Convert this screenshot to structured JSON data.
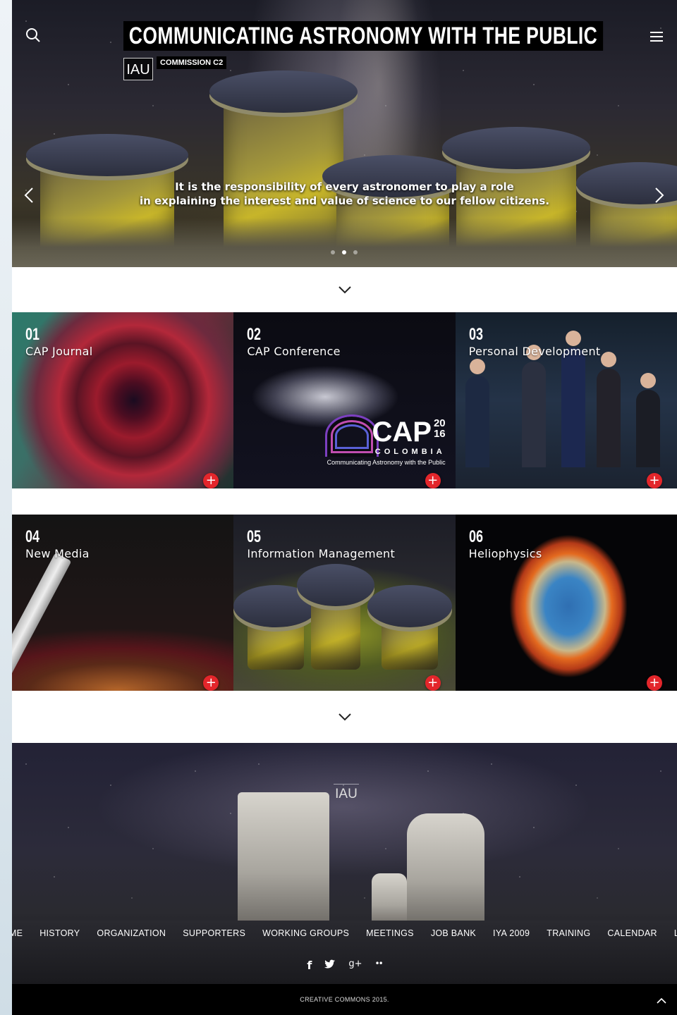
{
  "header": {
    "title": "COMMUNICATING ASTRONOMY WITH THE PUBLIC",
    "logo_text": "IAU",
    "commission": "COMMISSION C2",
    "search_icon": "search-icon",
    "menu_icon": "hamburger-menu-icon"
  },
  "hero": {
    "quote_line1": "It is the responsibility of every astronomer to play a role",
    "quote_line2": "in explaining the interest and value of science to our fellow citizens.",
    "prev_icon": "chevron-left-icon",
    "next_icon": "chevron-right-icon",
    "slides": 3,
    "active_slide": 2
  },
  "tiles": [
    {
      "num": "01",
      "label": "CAP Journal"
    },
    {
      "num": "02",
      "label": "CAP Conference"
    },
    {
      "num": "03",
      "label": "Personal Development"
    },
    {
      "num": "04",
      "label": "New Media"
    },
    {
      "num": "05",
      "label": "Information Management"
    },
    {
      "num": "06",
      "label": "Heliophysics"
    }
  ],
  "cap_logo": {
    "big": "CAP",
    "year_top": "20",
    "year_bottom": "16",
    "country": "COLOMBIA",
    "tagline": "Communicating Astronomy with the Public"
  },
  "footer": {
    "logo_text": "IAU",
    "nav": [
      "HOME",
      "HISTORY",
      "ORGANIZATION",
      "SUPPORTERS",
      "WORKING GROUPS",
      "MEETINGS",
      "JOB BANK",
      "IYA 2009",
      "TRAINING",
      "CALENDAR",
      "LINKS"
    ],
    "social": [
      "f",
      "t",
      "g+",
      "••"
    ],
    "copyright": "CREATIVE COMMONS 2015."
  },
  "colors": {
    "accent": "#e3262b",
    "bar": "#000000"
  }
}
